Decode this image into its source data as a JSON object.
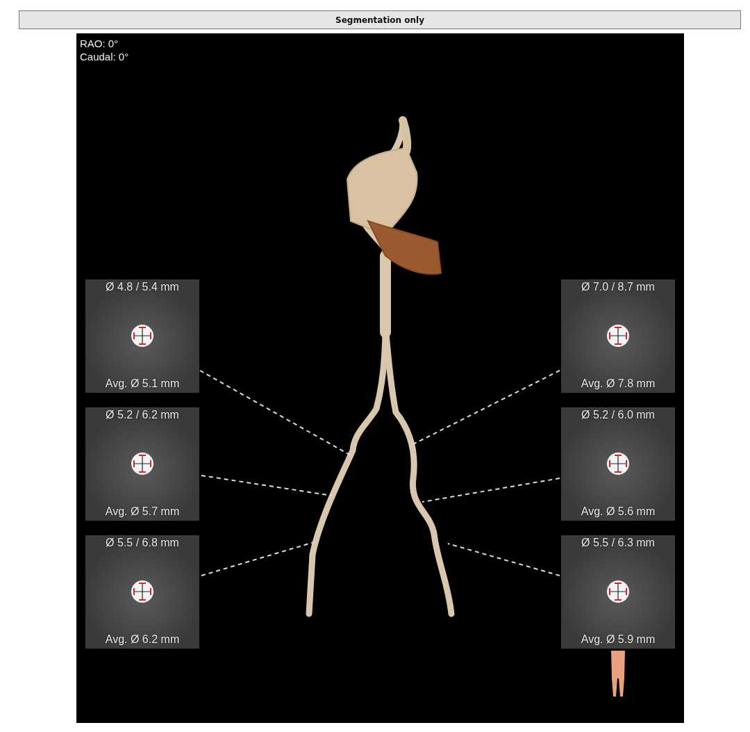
{
  "header": {
    "title": "Segmentation only"
  },
  "viewer": {
    "orientation": [
      "RAO: 0°",
      "Caudal: 0°"
    ],
    "left_sections": [
      {
        "diameters": "Ø 4.8 / 5.4 mm",
        "average": "Avg. Ø 5.1 mm"
      },
      {
        "diameters": "Ø 5.2 / 6.2 mm",
        "average": "Avg. Ø 5.7 mm"
      },
      {
        "diameters": "Ø 5.5 / 6.8 mm",
        "average": "Avg. Ø 6.2 mm"
      }
    ],
    "right_sections": [
      {
        "diameters": "Ø 7.0 / 8.7 mm",
        "average": "Avg. Ø 7.8 mm"
      },
      {
        "diameters": "Ø 5.2 / 6.0 mm",
        "average": "Avg. Ø 5.6 mm"
      },
      {
        "diameters": "Ø 5.5 / 6.3 mm",
        "average": "Avg. Ø 5.9 mm"
      }
    ]
  }
}
